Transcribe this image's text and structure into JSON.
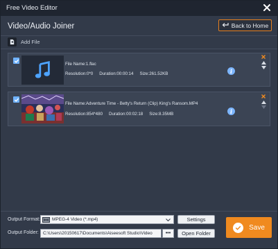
{
  "window": {
    "title": "Free Video Editor"
  },
  "header": {
    "title": "Video/Audio Joiner",
    "back_label": "Back to Home"
  },
  "toolbar": {
    "add_file_label": "Add File"
  },
  "files": [
    {
      "name": "File Name:1.flac",
      "resolution": "Resolution:0*0",
      "duration": "Duration:00:00:14",
      "size": "Size:261.52KB",
      "checked": true,
      "thumb": "music-note-icon"
    },
    {
      "name": "File Name:Adventure Time - Betty's Return (Clip) King's Ransom.MP4",
      "resolution": "Resolution:854*480",
      "duration": "Duration:00:02:18",
      "size": "Size:8.35MB",
      "checked": true,
      "thumb": "video-frame"
    }
  ],
  "output": {
    "format_label": "Output Format:",
    "format_value": "MPEG-4 Video (*.mp4)",
    "folder_label": "Output Folder:",
    "folder_path": "C:\\Users\\20150617\\Documents\\Aiseesoft Studio\\Video",
    "browse_label": "•••",
    "settings_label": "Settings",
    "open_folder_label": "Open Folder",
    "save_label": "Save"
  },
  "colors": {
    "background": "#323a49",
    "titlebar": "#1f2530",
    "accent": "#f08a1f",
    "info": "#7db6ff",
    "checkbox": "#6fb2ff"
  }
}
